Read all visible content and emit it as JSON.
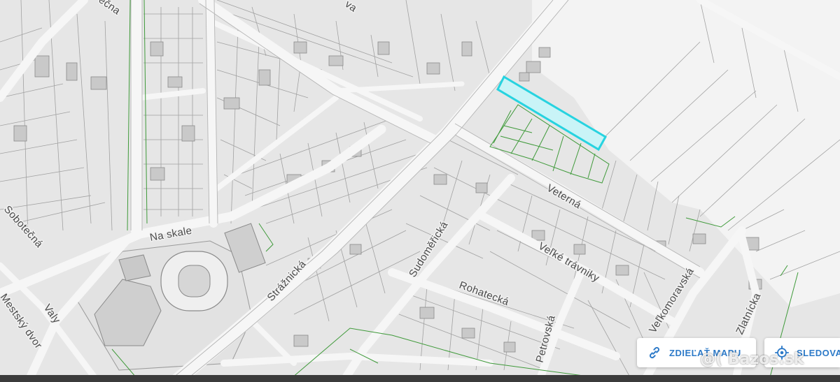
{
  "map": {
    "streets": [
      {
        "id": "na-skale",
        "label": "Na skale"
      },
      {
        "id": "straznicka",
        "label": "Strážnická"
      },
      {
        "id": "sudomericka",
        "label": "Sudoměřická"
      },
      {
        "id": "rohatecka",
        "label": "Rohatecká"
      },
      {
        "id": "veterna",
        "label": "Veterná"
      },
      {
        "id": "velke-travniky",
        "label": "Veľké trávniky"
      },
      {
        "id": "velkomoravska",
        "label": "Veľkomoravská"
      },
      {
        "id": "zlatnicka",
        "label": "Zlatnícka"
      },
      {
        "id": "petrovska",
        "label": "Petrovská"
      },
      {
        "id": "sobotecna",
        "label": "Sobotečná"
      },
      {
        "id": "valy",
        "label": "Valy"
      },
      {
        "id": "mestsky-dvor",
        "label": "Mestský dvor"
      },
      {
        "id": "ecna",
        "label": "ečna"
      },
      {
        "id": "va",
        "label": "va"
      }
    ],
    "highlight_color": "#27d3e0",
    "cadastre_color": "#3f9a3a"
  },
  "controls": {
    "share_label": "ZDIEĽAŤ MAPU",
    "share_icon": "link-icon",
    "follow_label": "SLEDOVAŤ",
    "follow_icon": "locate-icon"
  },
  "watermark": {
    "text": "@( Bazos.sk"
  }
}
